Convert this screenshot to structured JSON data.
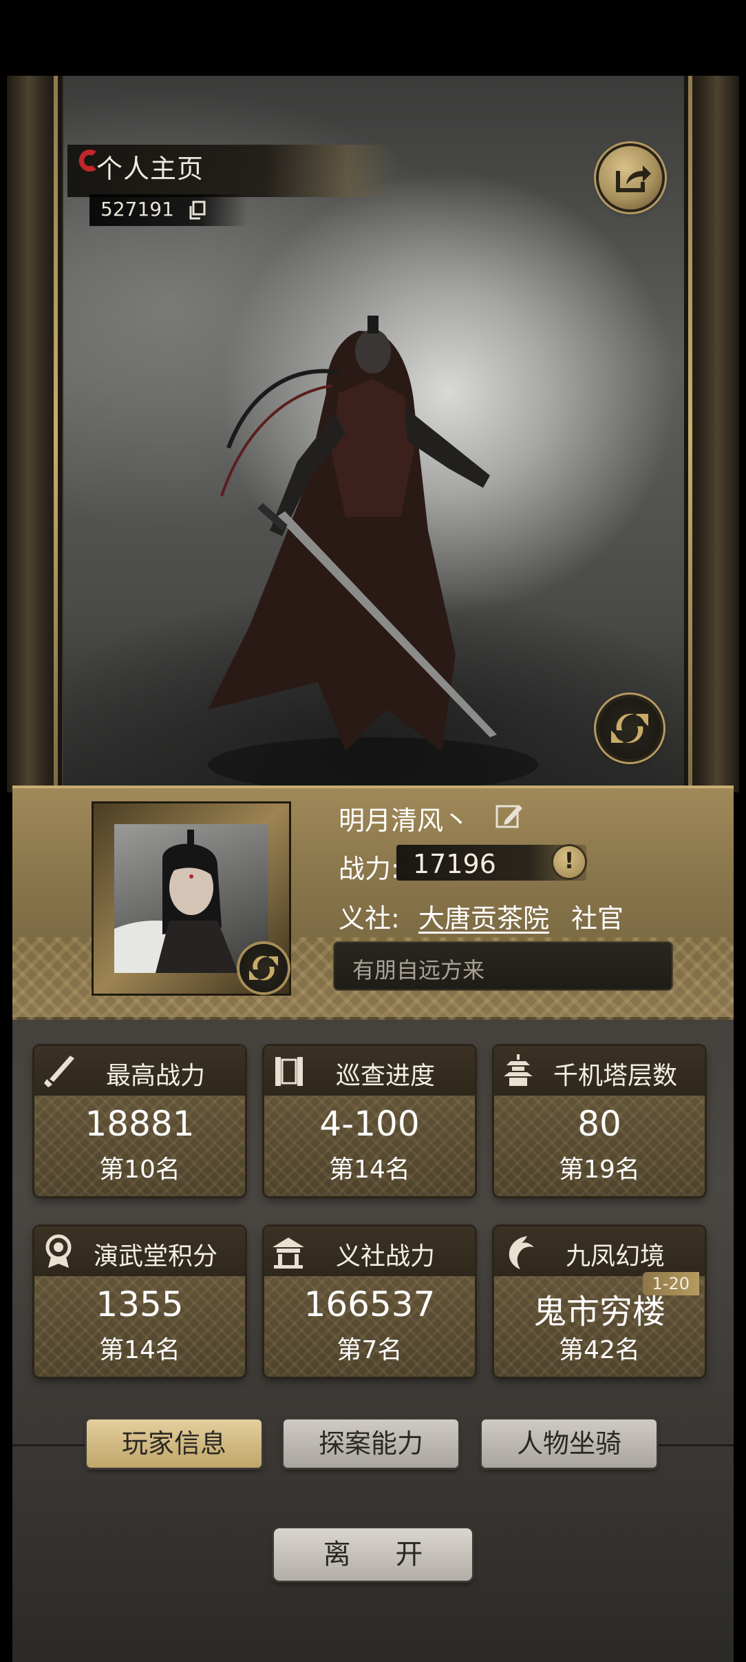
{
  "header": {
    "title": "个人主页",
    "player_id": "527191",
    "copy_icon": "copy-icon",
    "share_icon": "share-icon",
    "swap_icon": "refresh-icon"
  },
  "profile": {
    "name": "明月清风丶",
    "edit_icon": "edit-icon",
    "power_label": "战力:",
    "power_value": "17196",
    "info_icon": "exclamation-icon",
    "info_symbol": "!",
    "guild_label": "义社:",
    "guild_name": "大唐贡茶院",
    "guild_role": "社官",
    "motto": "有朋自远方来"
  },
  "stats": [
    {
      "label": "最高战力",
      "value": "18881",
      "rank": "第10名",
      "icon": "sword-icon"
    },
    {
      "label": "巡查进度",
      "value": "4-100",
      "rank": "第14名",
      "icon": "scroll-icon"
    },
    {
      "label": "千机塔层数",
      "value": "80",
      "rank": "第19名",
      "icon": "pagoda-icon"
    },
    {
      "label": "演武堂积分",
      "value": "1355",
      "rank": "第14名",
      "icon": "medal-icon"
    },
    {
      "label": "义社战力",
      "value": "166537",
      "rank": "第7名",
      "icon": "hall-icon"
    },
    {
      "label": "九凤幻境",
      "value": "鬼市穷楼",
      "rank": "第42名",
      "icon": "phoenix-icon",
      "badge": "1-20"
    }
  ],
  "tabs": [
    {
      "label": "玩家信息",
      "active": true
    },
    {
      "label": "探案能力",
      "active": false
    },
    {
      "label": "人物坐骑",
      "active": false
    }
  ],
  "leave_label": "离 开",
  "colors": {
    "gold": "#a18a5a",
    "card": "#5b4e35",
    "tab_active": "#d8c08a"
  }
}
